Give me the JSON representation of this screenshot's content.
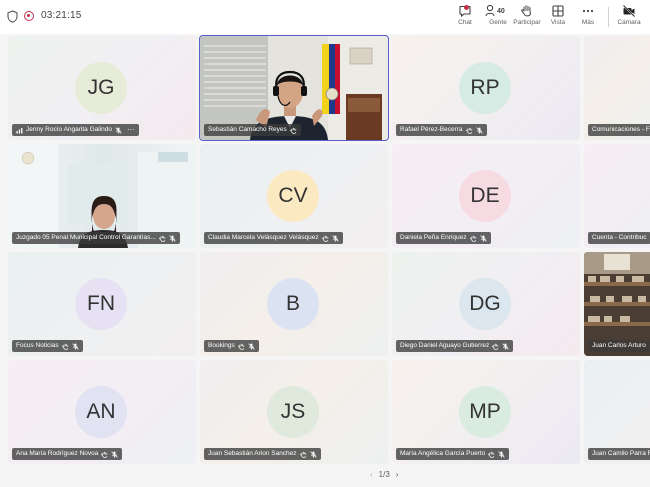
{
  "call": {
    "timer": "03:21:15"
  },
  "toolbar": {
    "chat": "Chat",
    "people": "Gente",
    "people_count": "40",
    "participate": "Participar",
    "view": "Vista",
    "more": "Más",
    "camera": "Cámara"
  },
  "tiles": [
    {
      "name": "Jenny Rocío Angarita Galindo",
      "initials": "JG",
      "avatar_color": "#e7ecd9"
    },
    {
      "name": "Sebastián Camacho Reyes",
      "initials": "",
      "avatar_color": ""
    },
    {
      "name": "Rafael Pérez-Becerra",
      "initials": "RP",
      "avatar_color": "#d6ebe4"
    },
    {
      "name": "Comunicaciones - F",
      "initials": "",
      "avatar_color": ""
    },
    {
      "name": "Juzgado 05 Penal Municipal Control Garantías...",
      "initials": "",
      "avatar_color": ""
    },
    {
      "name": "Claudia Marcela Velásquez Velásquez",
      "initials": "CV",
      "avatar_color": "#fbe9c2"
    },
    {
      "name": "Daniela Peña Enriquez",
      "initials": "DE",
      "avatar_color": "#f6dbe2"
    },
    {
      "name": "Cuenta - Contribuc",
      "initials": "",
      "avatar_color": ""
    },
    {
      "name": "Focus Noticias",
      "initials": "FN",
      "avatar_color": "#e6e2f3"
    },
    {
      "name": "Bookings",
      "initials": "B",
      "avatar_color": "#dbe3f3"
    },
    {
      "name": "Diego Daniel Aguayo Gutierrez",
      "initials": "DG",
      "avatar_color": "#dbe6ee"
    },
    {
      "name": "Juan Carlos Arturo",
      "initials": "",
      "avatar_color": ""
    },
    {
      "name": "Ana María Rodríguez Novoa",
      "initials": "AN",
      "avatar_color": "#e1e2f2"
    },
    {
      "name": "Juan Sebastián Arion Sanchez",
      "initials": "JS",
      "avatar_color": "#dfeadd"
    },
    {
      "name": "María Angélica García Puerto",
      "initials": "MP",
      "avatar_color": "#d9ecdf"
    },
    {
      "name": "Juan Camilo Parra F",
      "initials": "",
      "avatar_color": ""
    }
  ],
  "pager": {
    "label": "1/3"
  }
}
